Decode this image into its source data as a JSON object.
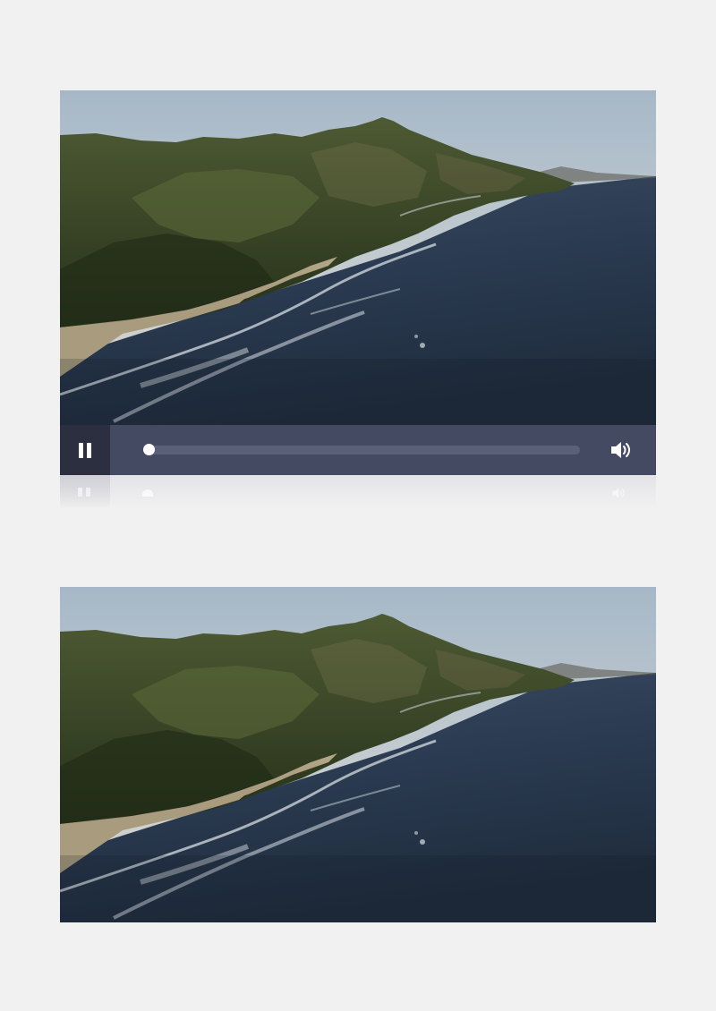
{
  "player": {
    "state": "playing",
    "progress": 0.0,
    "colors": {
      "control_bar": "#454a63",
      "play_button_bg": "#2b2f40",
      "track": "#5b6079",
      "thumb": "#ffffff"
    },
    "icons": {
      "play_button": "pause-icon",
      "volume_button": "speaker-volume-icon"
    }
  },
  "frames": {
    "top": {
      "icon": "video-frame-coastline"
    },
    "bottom": {
      "icon": "video-frame-coastline"
    }
  },
  "page": {
    "background": "#f1f1f1"
  }
}
